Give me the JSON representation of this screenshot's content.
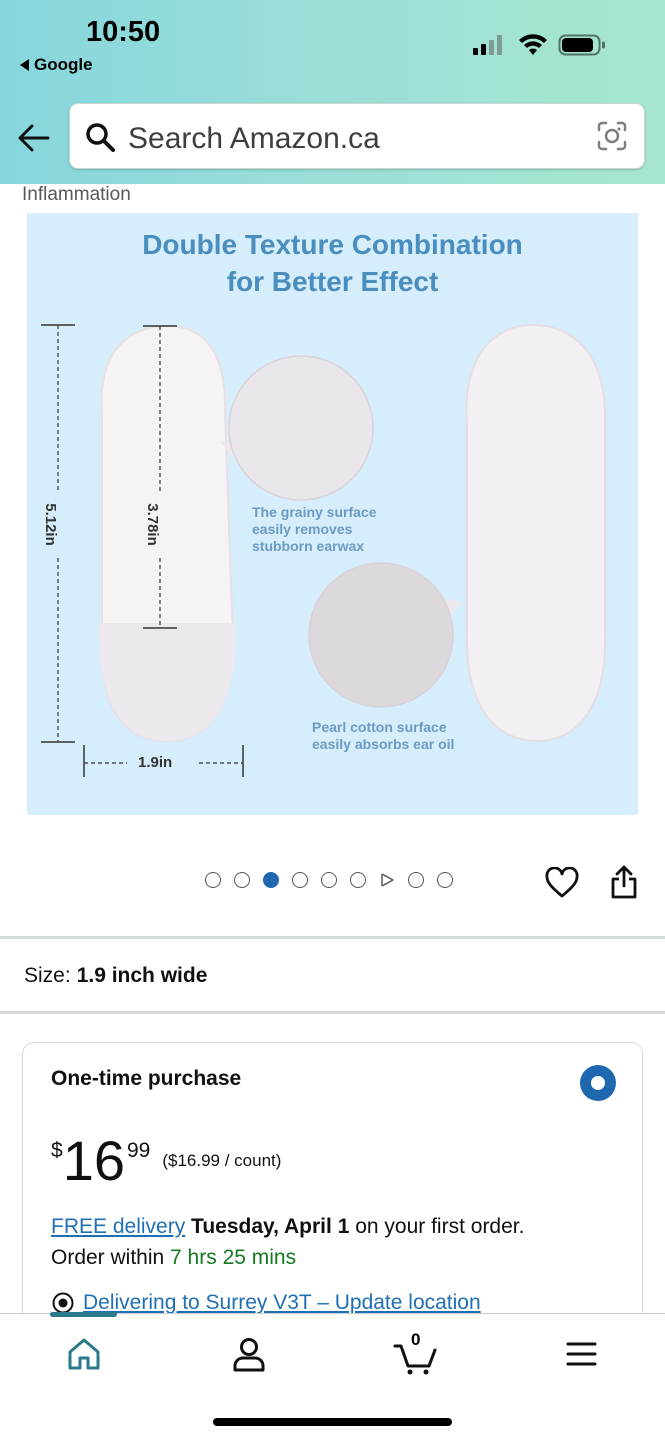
{
  "status_bar": {
    "time": "10:50",
    "back_app": "Google"
  },
  "search": {
    "placeholder": "Search Amazon.ca"
  },
  "product": {
    "truncated_text": "Inflammation",
    "image": {
      "title_line1": "Double Texture Combination",
      "title_line2": "for Better Effect",
      "caption_grainy": [
        "The grainy surface",
        "easily removes",
        "stubborn earwax"
      ],
      "caption_pearl": [
        "Pearl cotton surface",
        "easily absorbs ear oil"
      ],
      "dim_length": "5.12in",
      "dim_inner": "3.78in",
      "dim_width": "1.9in"
    },
    "carousel": {
      "total_dots": 9,
      "active_index": 2,
      "video_index": 6
    }
  },
  "size": {
    "label": "Size:",
    "value": "1.9 inch wide"
  },
  "purchase": {
    "title": "One-time purchase",
    "price_currency": "$",
    "price_whole": "16",
    "price_fraction": "99",
    "unit_price": "($16.99 / count)",
    "delivery_link": "FREE delivery",
    "delivery_date": "Tuesday, April 1",
    "delivery_suffix": "on your first order.",
    "order_within_label": "Order within",
    "order_within_time": "7 hrs 25 mins",
    "location_text": "Delivering to Surrey V3T – Update location"
  },
  "bottom_nav": {
    "cart_count": "0",
    "active": "home"
  },
  "colors": {
    "accent_blue": "#1f68b0",
    "link_blue": "#1f6fb4",
    "green": "#137a21",
    "header_start": "#86d6dd",
    "header_end": "#a7e6cf"
  }
}
